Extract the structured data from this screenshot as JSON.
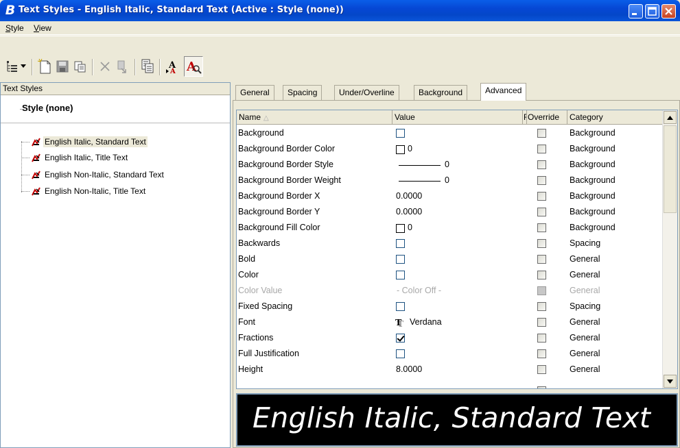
{
  "window": {
    "title": "Text Styles - English Italic, Standard Text (Active : Style (none))",
    "app_icon": "bentley-b-icon"
  },
  "menu": {
    "items": [
      {
        "label": "Style",
        "accel": "S"
      },
      {
        "label": "View",
        "accel": "V"
      }
    ]
  },
  "toolbar": {
    "buttons": [
      "tree-view-icon",
      "dropdown-arrow-icon",
      "new-icon",
      "save-icon",
      "copy-icon",
      "delete-icon",
      "reset-icon",
      "update-icon",
      "apply-text-style-icon",
      "text-style-toggle-icon"
    ]
  },
  "left_pane": {
    "header": "Text Styles",
    "root": "Style (none)",
    "items": [
      {
        "label": "English Italic, Standard Text",
        "selected": true
      },
      {
        "label": "English Italic, Title Text",
        "selected": false
      },
      {
        "label": "English Non-Italic, Standard Text",
        "selected": false
      },
      {
        "label": "English Non-Italic, Title Text",
        "selected": false
      }
    ]
  },
  "tabs": [
    {
      "label": "General",
      "active": false
    },
    {
      "label": "Spacing",
      "active": false
    },
    {
      "label": "Under/Overline",
      "active": false
    },
    {
      "label": "Background",
      "active": false
    },
    {
      "label": "Advanced",
      "active": true
    }
  ],
  "grid": {
    "columns": {
      "name": "Name",
      "value": "Value",
      "f": "F",
      "override": "Override",
      "category": "Category"
    },
    "rows": [
      {
        "name": "Background",
        "value_type": "checkbox",
        "value": "",
        "checked": false,
        "category": "Background"
      },
      {
        "name": "Background Border Color",
        "value_type": "color",
        "value": "0",
        "category": "Background"
      },
      {
        "name": "Background Border Style",
        "value_type": "line",
        "value": "0",
        "category": "Background"
      },
      {
        "name": "Background Border Weight",
        "value_type": "line",
        "value": "0",
        "category": "Background"
      },
      {
        "name": "Background Border X",
        "value_type": "text",
        "value": "0.0000",
        "category": "Background"
      },
      {
        "name": "Background Border Y",
        "value_type": "text",
        "value": "0.0000",
        "category": "Background"
      },
      {
        "name": "Background Fill Color",
        "value_type": "color",
        "value": "0",
        "category": "Background"
      },
      {
        "name": "Backwards",
        "value_type": "checkbox",
        "value": "",
        "checked": false,
        "category": "Spacing"
      },
      {
        "name": "Bold",
        "value_type": "checkbox",
        "value": "",
        "checked": false,
        "category": "General"
      },
      {
        "name": "Color",
        "value_type": "checkbox",
        "value": "",
        "checked": false,
        "category": "General"
      },
      {
        "name": "Color Value",
        "value_type": "text",
        "value": "- Color Off -",
        "disabled": true,
        "category": "General"
      },
      {
        "name": "Fixed Spacing",
        "value_type": "checkbox",
        "value": "",
        "checked": false,
        "category": "Spacing"
      },
      {
        "name": "Font",
        "value_type": "font",
        "value": "Verdana",
        "category": "General"
      },
      {
        "name": "Fractions",
        "value_type": "checkbox",
        "value": "",
        "checked": true,
        "category": "General"
      },
      {
        "name": "Full Justification",
        "value_type": "checkbox",
        "value": "",
        "checked": false,
        "category": "General"
      },
      {
        "name": "Height",
        "value_type": "text",
        "value": "8.0000",
        "category": "General"
      }
    ]
  },
  "preview": {
    "text": "English Italic, Standard Text"
  }
}
